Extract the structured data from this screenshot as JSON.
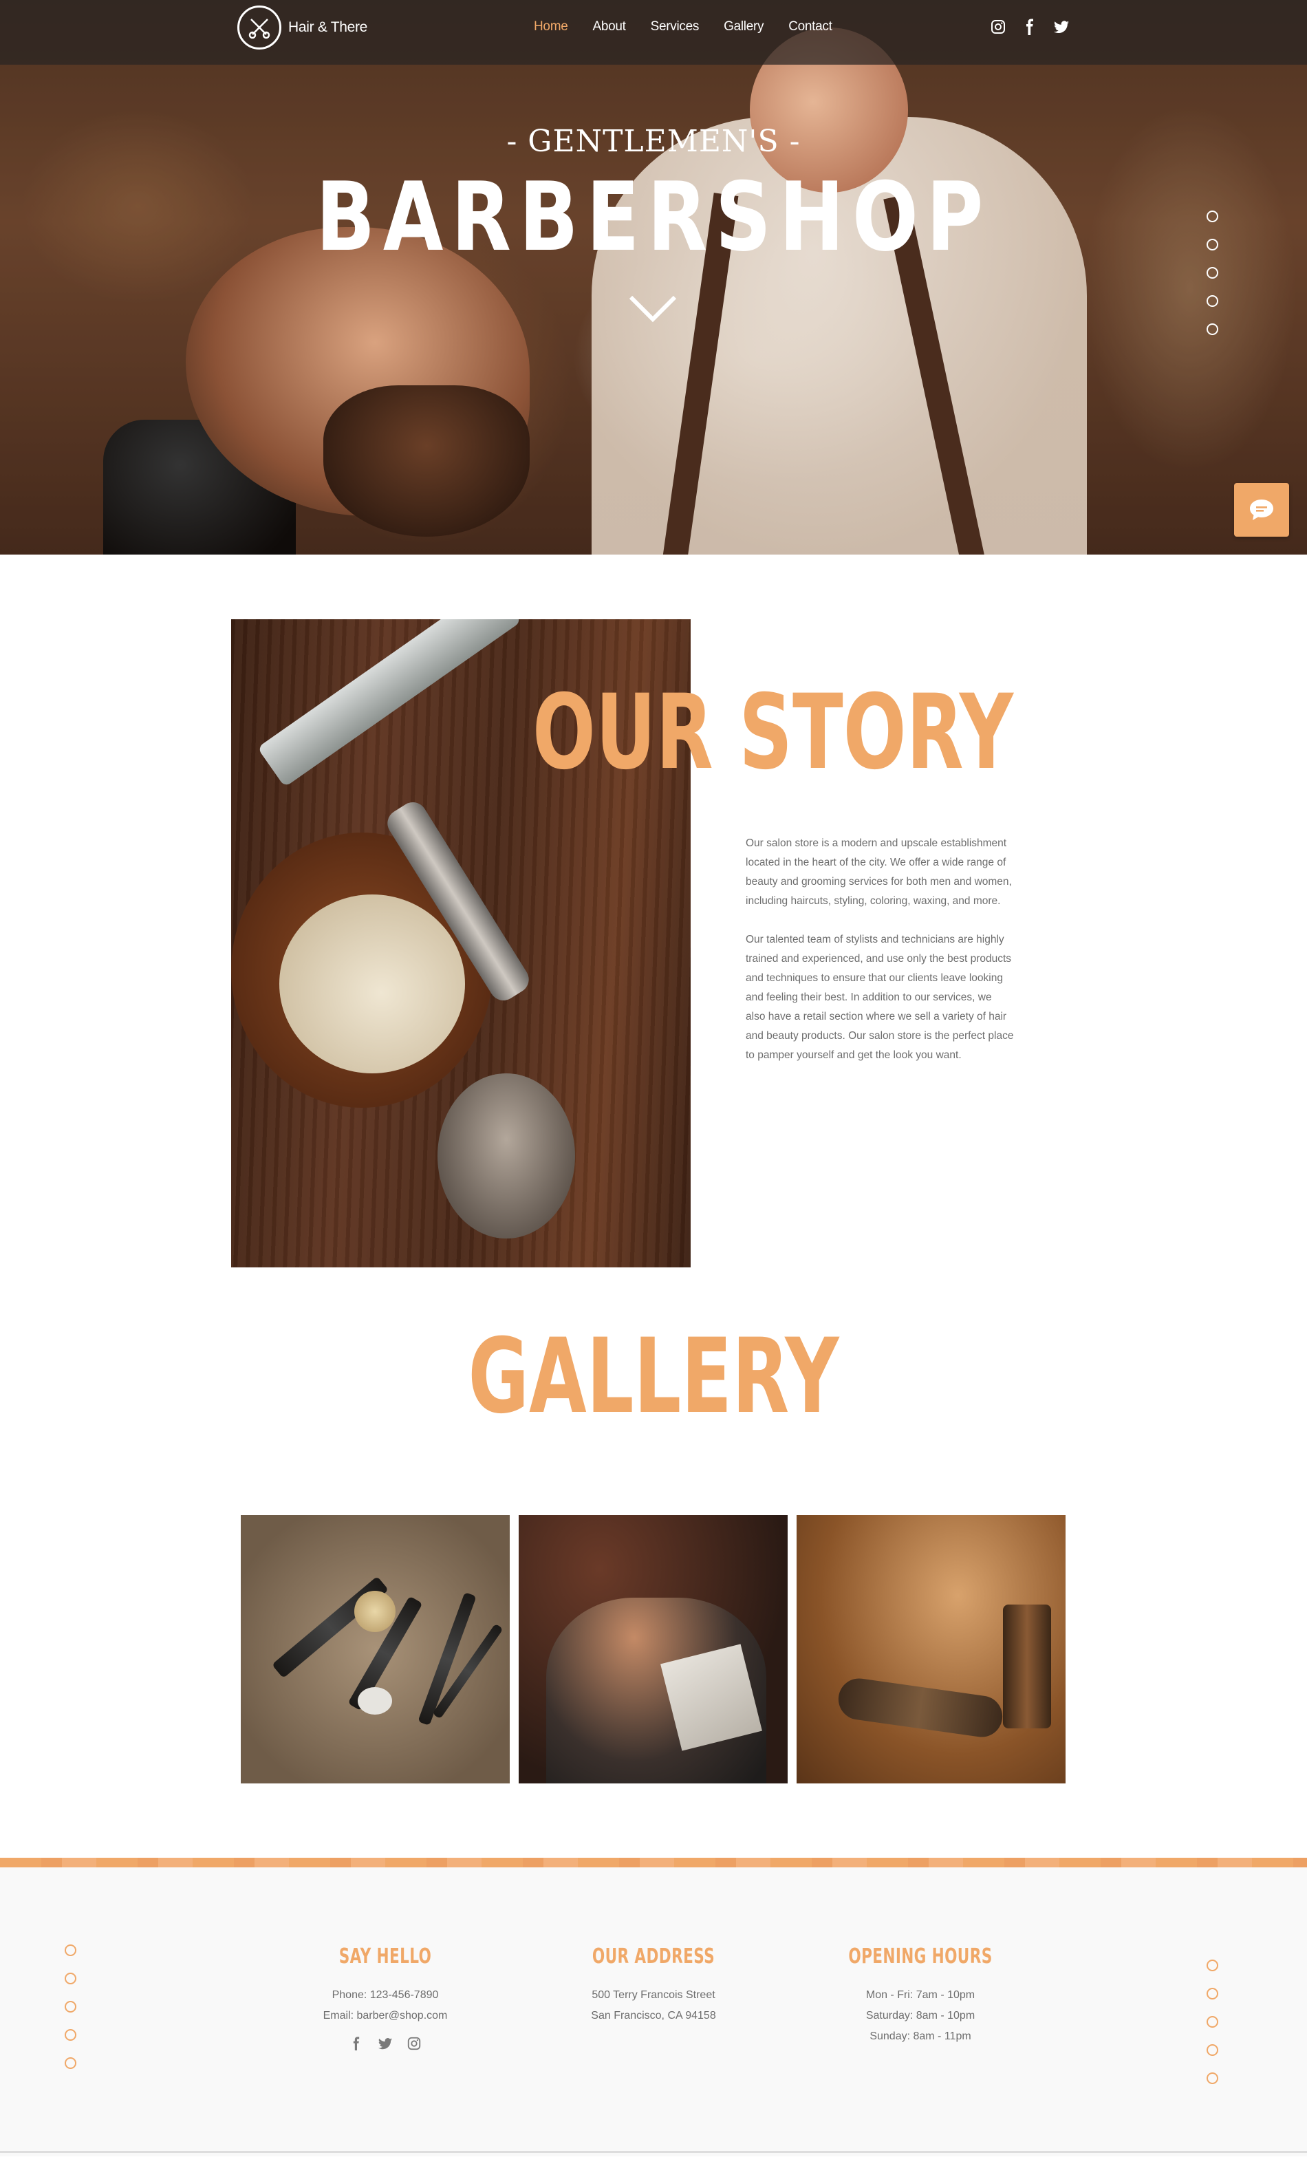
{
  "brand": {
    "name": "Hair & There"
  },
  "nav": {
    "items": [
      {
        "label": "Home",
        "active": true
      },
      {
        "label": "About",
        "active": false
      },
      {
        "label": "Services",
        "active": false
      },
      {
        "label": "Gallery",
        "active": false
      },
      {
        "label": "Contact",
        "active": false
      }
    ]
  },
  "social_top": [
    "instagram-icon",
    "facebook-icon",
    "twitter-icon"
  ],
  "hero": {
    "subtitle": "- GENTLEMEN'S -",
    "title": "BARBERSHOP"
  },
  "story": {
    "title": "OUR STORY",
    "paragraphs": [
      "Our salon store is a modern and upscale establishment located in the heart of the city. We offer a wide range of beauty and grooming services for both men and women, including haircuts, styling, coloring, waxing, and more.",
      "Our talented team of stylists and technicians are highly trained and experienced, and use only the best products and techniques to ensure that our clients leave looking and feeling their best. In addition to our services, we also have a retail section where we sell a variety of hair and beauty products. Our salon store is the perfect place to pamper yourself and get the look you want."
    ]
  },
  "gallery": {
    "title": "GALLERY"
  },
  "footer": {
    "say_hello": {
      "title": "SAY HELLO",
      "phone": "Phone: 123-456-7890",
      "email": "Email:  barber@shop.com"
    },
    "address": {
      "title": "OUR ADDRESS",
      "line1": "500 Terry Francois Street",
      "line2": "San Francisco, CA 94158"
    },
    "hours": {
      "title": "OPENING HOURS",
      "line1": "Mon - Fri: 7am - 10pm",
      "line2": "Saturday: 8am - 10pm",
      "line3": "Sunday: 8am - 11pm"
    }
  },
  "colors": {
    "accent": "#f0a868",
    "topbar": "#282422",
    "text": "#6d6d6d",
    "footer_bg": "#f9f9f9"
  }
}
